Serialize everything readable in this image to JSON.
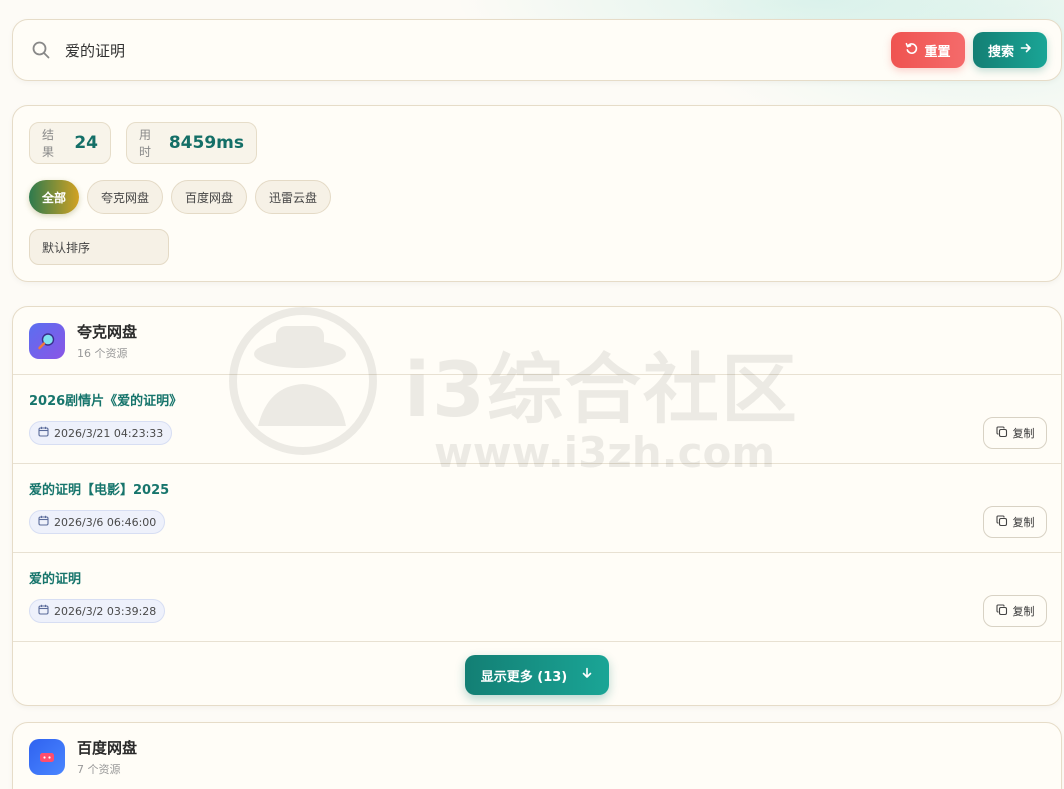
{
  "search": {
    "value": "爱的证明",
    "reset_label": "重置",
    "search_label": "搜索"
  },
  "stats": {
    "results_label": "结果",
    "results_value": "24",
    "time_label": "用时",
    "time_value": "8459ms"
  },
  "filters": [
    "全部",
    "夸克网盘",
    "百度网盘",
    "迅雷云盘"
  ],
  "sort_label": "默认排序",
  "watermark": {
    "text": "i3综合社区",
    "url": "www.i3zh.com"
  },
  "groups": {
    "quark": {
      "title": "夸克网盘",
      "count": "16 个资源",
      "items": [
        {
          "title": "2026剧情片《爱的证明》",
          "date": "2026/3/21 04:23:33",
          "copy": "复制"
        },
        {
          "title": "爱的证明【电影】2025",
          "date": "2026/3/6 06:46:00",
          "copy": "复制"
        },
        {
          "title": "爱的证明",
          "date": "2026/3/2 03:39:28",
          "copy": "复制"
        }
      ],
      "more_label": "显示更多 (13)"
    },
    "baidu": {
      "title": "百度网盘",
      "count": "7 个资源"
    }
  },
  "colors": {
    "accent": "#137f74",
    "danger": "#ef5350",
    "quark": "#5a6ff0",
    "baidu": "#2f62f0"
  }
}
